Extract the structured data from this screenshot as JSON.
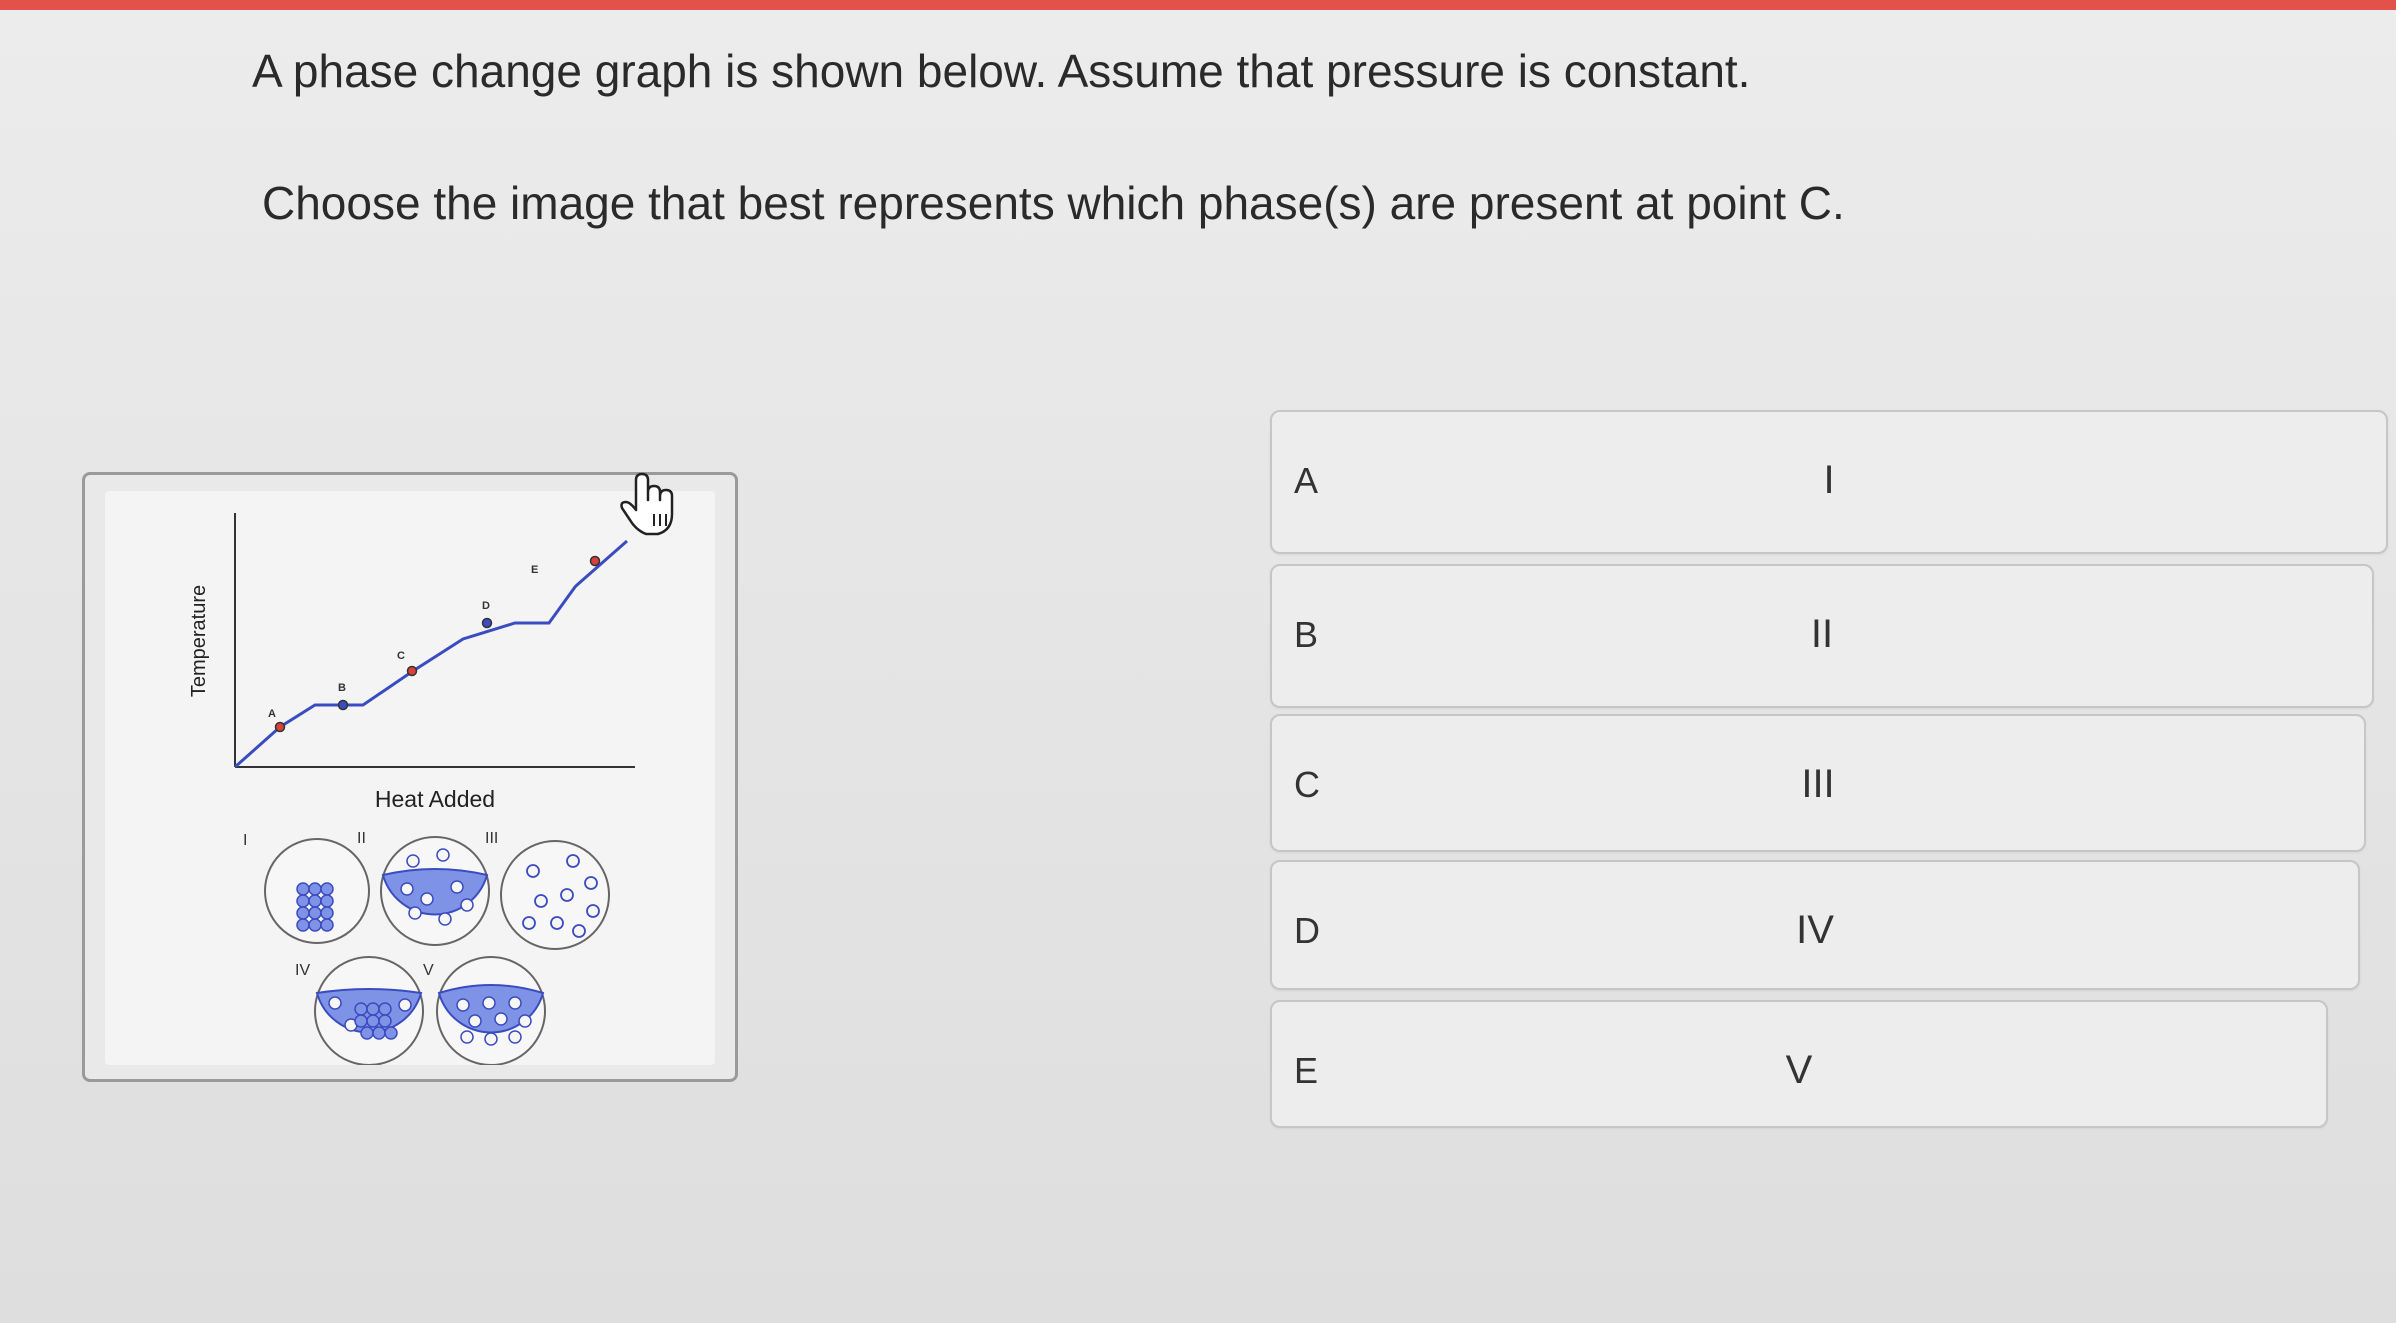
{
  "question": {
    "line1": "A phase change graph is shown below. Assume that pressure is constant.",
    "line2": "Choose the image that best represents which phase(s) are present at point C."
  },
  "figure": {
    "ylabel": "Temperature",
    "xlabel": "Heat Added",
    "points": [
      "A",
      "B",
      "C",
      "D",
      "E"
    ],
    "circle_labels": [
      "I",
      "II",
      "III",
      "IV",
      "V"
    ],
    "accent": "#5a6ed8",
    "particle_fill": "#7f93e6"
  },
  "options": [
    {
      "letter": "A",
      "label": "I"
    },
    {
      "letter": "B",
      "label": "II"
    },
    {
      "letter": "C",
      "label": "III"
    },
    {
      "letter": "D",
      "label": "IV"
    },
    {
      "letter": "E",
      "label": "V"
    }
  ],
  "cursor": {
    "icon": "hand-pointer-icon"
  },
  "colors": {
    "top_bar": "#e2524a"
  }
}
